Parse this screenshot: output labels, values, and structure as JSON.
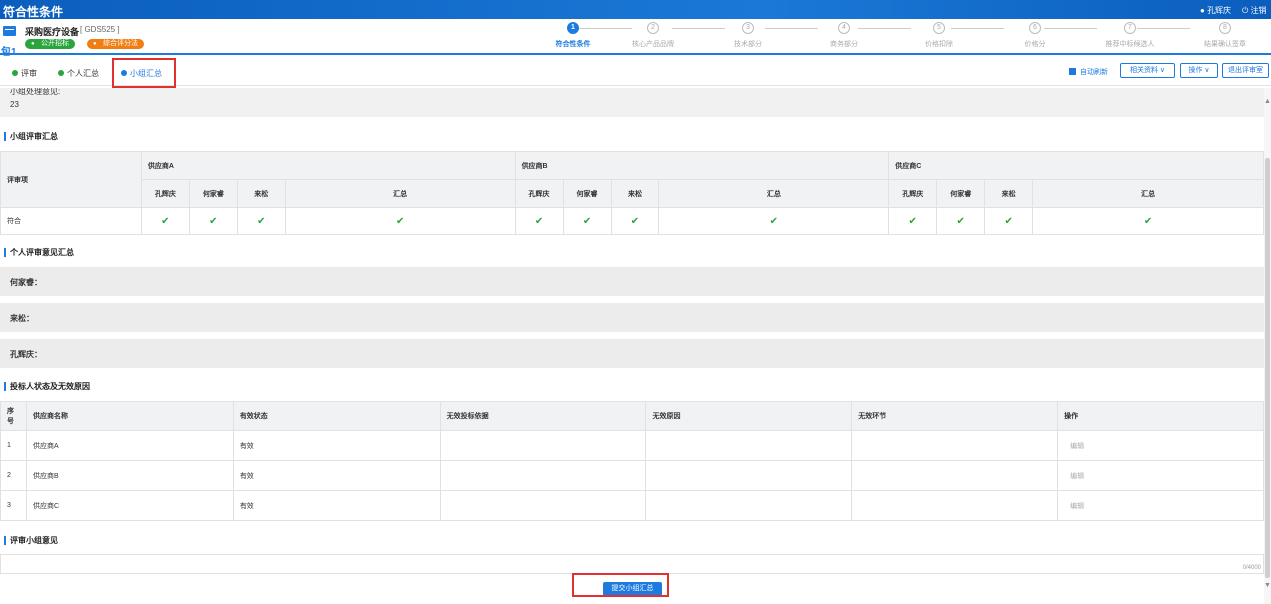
{
  "header": {
    "title": "符合性条件",
    "user": "孔辉庆",
    "logout": "注销"
  },
  "project": {
    "name": "采购医疗设备",
    "code": "[ GDS525 ]",
    "package": "包1",
    "badges": [
      "公开招标",
      "综合评分法"
    ]
  },
  "steps": [
    {
      "num": "1",
      "label": "符合性条件"
    },
    {
      "num": "2",
      "label": "核心产品品牌"
    },
    {
      "num": "3",
      "label": "技术部分"
    },
    {
      "num": "4",
      "label": "商务部分"
    },
    {
      "num": "5",
      "label": "价格扣除"
    },
    {
      "num": "6",
      "label": "价格分"
    },
    {
      "num": "7",
      "label": "推荐中标候选人"
    },
    {
      "num": "8",
      "label": "结果确认签章"
    }
  ],
  "tabs": [
    "评审",
    "个人汇总",
    "小组汇总"
  ],
  "toolbar": {
    "auto_refresh": "自动刷新",
    "related_docs": "相关资料 ∨",
    "operations": "操作 ∨",
    "exit_review": "退出评审室"
  },
  "top_opinion": {
    "label": "小组处理意见:",
    "value": "23"
  },
  "group_summary": {
    "title": "小组评审汇总",
    "row_header": "评审项",
    "suppliers": [
      "供应商A",
      "供应商B",
      "供应商C"
    ],
    "members": [
      "孔辉庆",
      "何家睿",
      "来松"
    ],
    "summary_label": "汇总",
    "row_label": "符合",
    "mark": "✔"
  },
  "personal_opinions": {
    "title": "个人评审意见汇总",
    "persons": [
      "何家睿：",
      "来松：",
      "孔辉庆："
    ]
  },
  "bidder_status": {
    "title": "投标人状态及无效原因",
    "columns": [
      "序号",
      "供应商名称",
      "有效状态",
      "无效投标依据",
      "无效原因",
      "无效环节",
      "操作"
    ],
    "rows": [
      {
        "no": "1",
        "name": "供应商A",
        "status": "有效",
        "action": "编辑"
      },
      {
        "no": "2",
        "name": "供应商B",
        "status": "有效",
        "action": "编辑"
      },
      {
        "no": "3",
        "name": "供应商C",
        "status": "有效",
        "action": "编辑"
      }
    ]
  },
  "group_opinion": {
    "title": "评审小组意见",
    "counter": "0/4000"
  },
  "submit_label": "提交小组汇总",
  "colors": {
    "primary": "#1d7be0",
    "check": "#2aa53b",
    "highlight": "#e0302f"
  }
}
